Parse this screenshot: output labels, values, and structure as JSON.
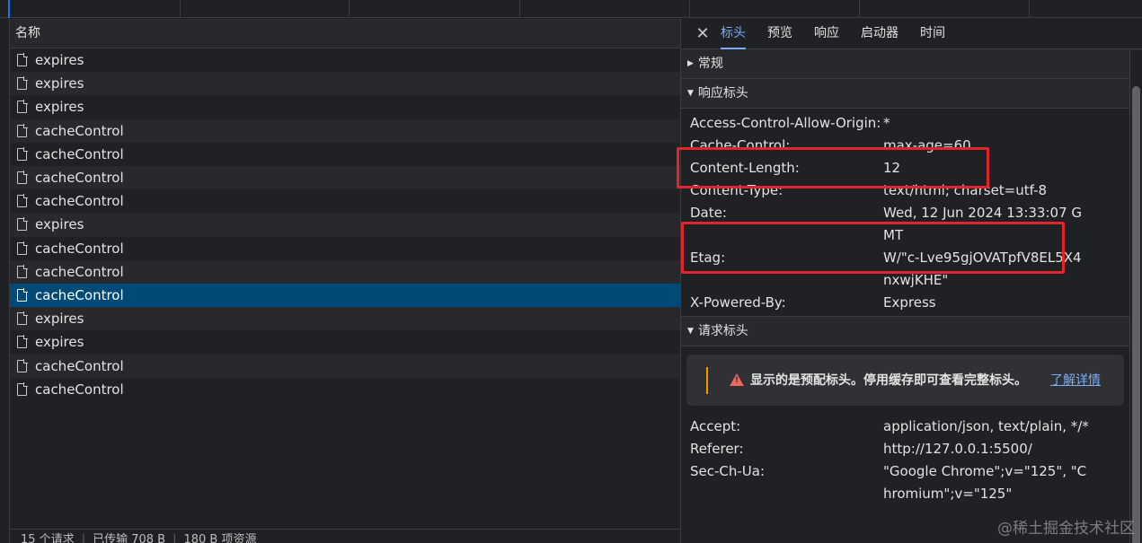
{
  "colors": {
    "accent": "#7cacf8",
    "selected_row": "#004a77",
    "highlight_box": "#e0252f",
    "warning": "#f29900"
  },
  "request_list": {
    "header": "名称",
    "rows": [
      {
        "name": "expires"
      },
      {
        "name": "expires"
      },
      {
        "name": "expires"
      },
      {
        "name": "cacheControl"
      },
      {
        "name": "cacheControl"
      },
      {
        "name": "cacheControl"
      },
      {
        "name": "cacheControl"
      },
      {
        "name": "expires"
      },
      {
        "name": "cacheControl"
      },
      {
        "name": "cacheControl"
      },
      {
        "name": "cacheControl",
        "selected": true
      },
      {
        "name": "expires"
      },
      {
        "name": "expires"
      },
      {
        "name": "cacheControl"
      },
      {
        "name": "cacheControl"
      }
    ],
    "footer": {
      "requests": "15 个请求",
      "transferred": "已传输 708 B",
      "resources": "180 B 项资源"
    }
  },
  "details": {
    "close_icon": "close-icon",
    "tabs": [
      "标头",
      "预览",
      "响应",
      "启动器",
      "时间"
    ],
    "active_tab": "标头",
    "sections": {
      "general": "常规",
      "response_headers": "响应标头",
      "request_headers": "请求标头"
    },
    "response_headers": [
      {
        "key": "Access-Control-Allow-Origin:",
        "value": "*"
      },
      {
        "key": "Cache-Control:",
        "value": "max-age=60"
      },
      {
        "key": "Content-Length:",
        "value": "12"
      },
      {
        "key": "Content-Type:",
        "value": "text/html; charset=utf-8"
      },
      {
        "key": "Date:",
        "value": "Wed, 12 Jun 2024 13:33:07 GMT"
      },
      {
        "key": "Etag:",
        "value": "W/\"c-Lve95gjOVATpfV8EL5X4nxwjKHE\""
      },
      {
        "key": "X-Powered-By:",
        "value": "Express"
      }
    ],
    "warning": {
      "text": "显示的是预配标头。停用缓存即可查看完整标头。",
      "link": "了解详情"
    },
    "request_headers": [
      {
        "key": "Accept:",
        "value": "application/json, text/plain, */*"
      },
      {
        "key": "Referer:",
        "value": "http://127.0.0.1:5500/"
      },
      {
        "key": "Sec-Ch-Ua:",
        "value": "\"Google Chrome\";v=\"125\", \"Chromium\";v=\"125\""
      }
    ]
  },
  "watermark": "@稀土掘金技术社区"
}
